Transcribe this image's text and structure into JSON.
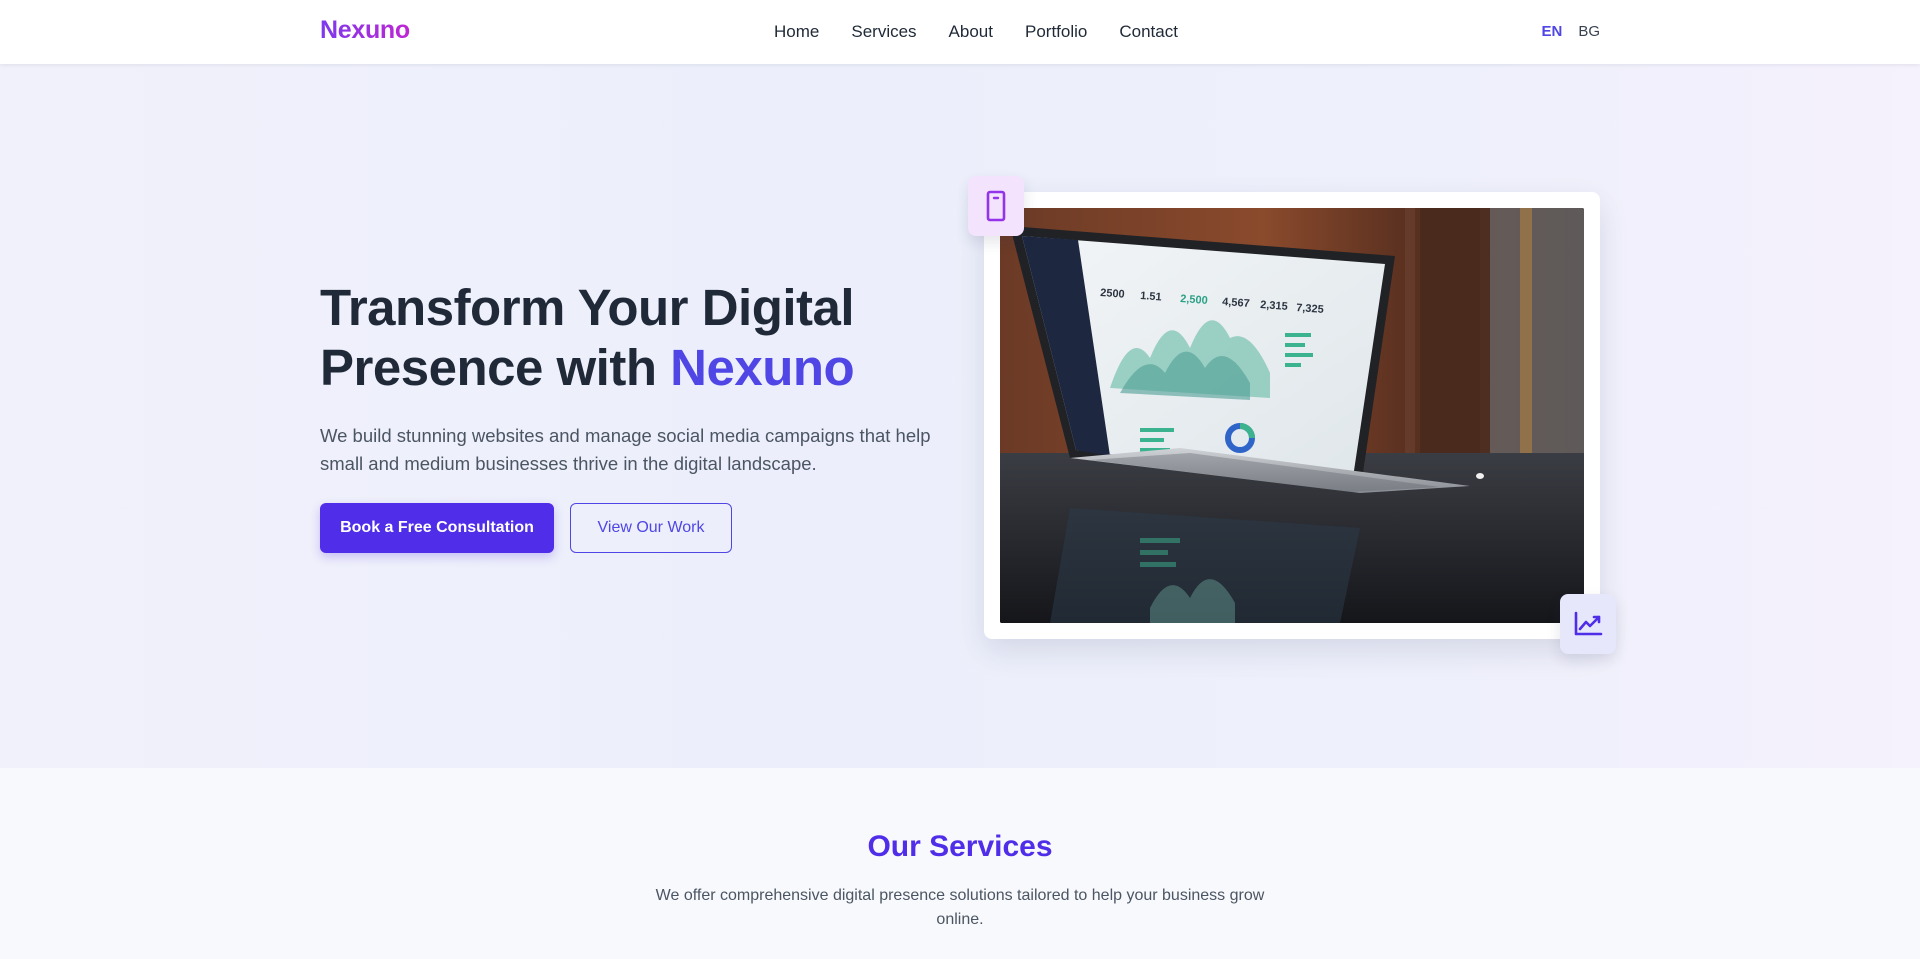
{
  "header": {
    "logo": "Nexuno",
    "nav": [
      "Home",
      "Services",
      "About",
      "Portfolio",
      "Contact"
    ],
    "languages": [
      "EN",
      "BG"
    ],
    "active_language": "EN"
  },
  "hero": {
    "title_line1": "Transform Your Digital",
    "title_line2_prefix": "Presence with ",
    "title_brand": "Nexuno",
    "subtitle": "We build stunning websites and manage social media campaigns that help small and medium businesses thrive in the digital landscape.",
    "primary_button": "Book a Free Consultation",
    "secondary_button": "View Our Work",
    "image_subject": "laptop-analytics-dashboard",
    "floating_icons": [
      "phone-icon",
      "chart-line-icon"
    ]
  },
  "services": {
    "title": "Our Services",
    "subtitle": "We offer comprehensive digital presence solutions tailored to help your business grow online."
  },
  "colors": {
    "accent": "#4f2de9",
    "brand_gradient_start": "#7c3aed",
    "brand_gradient_end": "#c026d3",
    "text_dark": "#1f2937",
    "text_muted": "#4b5563"
  }
}
